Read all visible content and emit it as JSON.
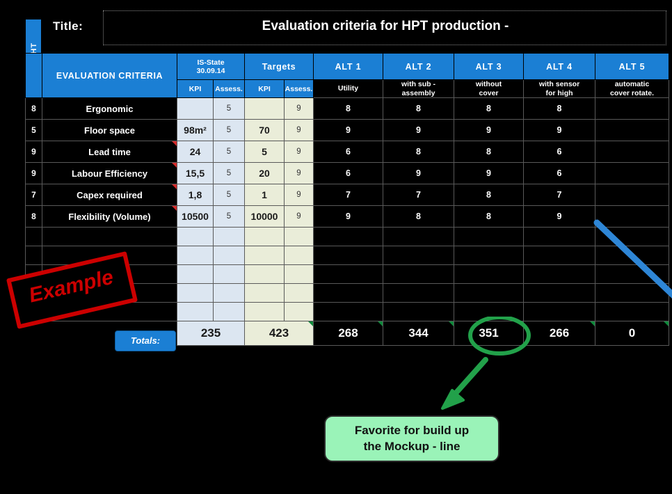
{
  "title_label": "Title:",
  "title_text": "Evaluation criteria for HPT production -",
  "weight_axis_label": "WEIGHT",
  "columns": {
    "criteria_header": "EVALUATION CRITERIA",
    "is_state_header": "IS-State\n30.09.14",
    "is_state_header_line1": "IS-State",
    "is_state_header_line2": "30.09.14",
    "targets_header": "Targets",
    "kpi_sub": "KPI",
    "assess_sub": "Assess."
  },
  "alternatives": [
    {
      "code": "ALT 1",
      "desc": "Utility"
    },
    {
      "code": "ALT 2",
      "desc": "with sub -\nassembly"
    },
    {
      "code": "ALT 3",
      "desc": "without\ncover"
    },
    {
      "code": "ALT 4",
      "desc": "with sensor\nfor high"
    },
    {
      "code": "ALT 5",
      "desc": "automatic\ncover rotate."
    }
  ],
  "rows": [
    {
      "weight": "8",
      "criteria": "Ergonomic",
      "is_kpi": "",
      "is_assess": "5",
      "tg_kpi": "",
      "tg_assess": "9",
      "alt_scores": [
        "8",
        "8",
        "8",
        "8",
        ""
      ],
      "comment_is": false
    },
    {
      "weight": "5",
      "criteria": "Floor space",
      "is_kpi": "98m²",
      "is_assess": "5",
      "tg_kpi": "70",
      "tg_assess": "9",
      "alt_scores": [
        "9",
        "9",
        "9",
        "9",
        ""
      ],
      "comment_is": false
    },
    {
      "weight": "9",
      "criteria": "Lead time",
      "is_kpi": "24",
      "is_assess": "5",
      "tg_kpi": "5",
      "tg_assess": "9",
      "alt_scores": [
        "6",
        "8",
        "8",
        "6",
        ""
      ],
      "comment_is": true
    },
    {
      "weight": "9",
      "criteria": "Labour Efficiency",
      "is_kpi": "15,5",
      "is_assess": "5",
      "tg_kpi": "20",
      "tg_assess": "9",
      "alt_scores": [
        "6",
        "9",
        "9",
        "6",
        ""
      ],
      "comment_is": true
    },
    {
      "weight": "7",
      "criteria": "Capex required",
      "is_kpi": "1,8",
      "is_assess": "5",
      "tg_kpi": "1",
      "tg_assess": "9",
      "alt_scores": [
        "7",
        "7",
        "8",
        "7",
        ""
      ],
      "comment_is": true
    },
    {
      "weight": "8",
      "criteria": "Flexibility (Volume)",
      "is_kpi": "10500",
      "is_assess": "5",
      "tg_kpi": "10000",
      "tg_assess": "9",
      "alt_scores": [
        "9",
        "8",
        "8",
        "9",
        ""
      ],
      "comment_is": true
    }
  ],
  "empty_row_count": 5,
  "totals": {
    "label": "Totals:",
    "is_state": "235",
    "targets": "423",
    "alt": [
      "268",
      "344",
      "351",
      "266",
      "0"
    ],
    "highlighted_index": 2
  },
  "annotations": {
    "example_stamp": "Example",
    "callout_line1": "Favorite for build up",
    "callout_line2": "the Mockup - line"
  },
  "colors": {
    "header_blue": "#1b7fd4",
    "is_state_fill": "#dce6f1",
    "targets_fill": "#eaedd9",
    "stamp_red": "#cc0000",
    "callout_green": "#9af3b8",
    "annotation_green": "#22a14a",
    "annotation_blue": "#2e86d6",
    "background": "#000000"
  }
}
